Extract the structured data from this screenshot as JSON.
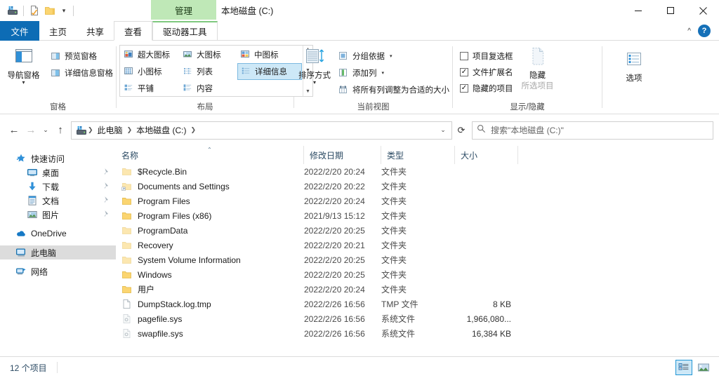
{
  "window": {
    "title": "本地磁盘 (C:)",
    "contextual_tab_label": "管理",
    "controls": {
      "minimize": "minimize-icon",
      "maximize": "maximize-icon",
      "close": "close-icon"
    }
  },
  "quick_access_toolbar": {
    "items": [
      {
        "name": "drive-icon",
        "label": ""
      },
      {
        "name": "properties-icon",
        "label": ""
      },
      {
        "name": "new-folder-icon",
        "label": ""
      }
    ],
    "customize_label": "▾"
  },
  "tabs": [
    {
      "label": "文件",
      "state": "file"
    },
    {
      "label": "主页",
      "state": "normal"
    },
    {
      "label": "共享",
      "state": "normal"
    },
    {
      "label": "查看",
      "state": "active"
    },
    {
      "label": "驱动器工具",
      "state": "contextual"
    }
  ],
  "ribbon_right": {
    "collapse": "^",
    "help": "?"
  },
  "ribbon": {
    "groups": [
      {
        "title": "窗格",
        "big_button": {
          "label": "导航窗格",
          "icon": "navigation-pane-icon",
          "has_dropdown": true
        },
        "small_buttons": [
          {
            "label": "预览窗格",
            "icon": "preview-pane-icon"
          },
          {
            "label": "详细信息窗格",
            "icon": "details-pane-icon"
          }
        ]
      },
      {
        "title": "布局",
        "gallery": [
          {
            "label": "超大图标",
            "icon": "extra-large-icons-icon",
            "selected": false
          },
          {
            "label": "大图标",
            "icon": "large-icons-icon",
            "selected": false
          },
          {
            "label": "中图标",
            "icon": "medium-icons-icon",
            "selected": false
          },
          {
            "label": "小图标",
            "icon": "small-icons-icon",
            "selected": false
          },
          {
            "label": "列表",
            "icon": "list-view-icon",
            "selected": false
          },
          {
            "label": "详细信息",
            "icon": "details-view-icon",
            "selected": true
          },
          {
            "label": "平铺",
            "icon": "tiles-view-icon",
            "selected": false
          },
          {
            "label": "内容",
            "icon": "content-view-icon",
            "selected": false
          }
        ]
      },
      {
        "title": "当前视图",
        "big_button": {
          "label": "排序方式",
          "icon": "sort-by-icon",
          "has_dropdown": true
        },
        "small_buttons": [
          {
            "label": "分组依据",
            "icon": "group-by-icon",
            "has_dropdown": true
          },
          {
            "label": "添加列",
            "icon": "add-columns-icon",
            "has_dropdown": true
          },
          {
            "label": "将所有列调整为合适的大小",
            "icon": "size-all-columns-icon",
            "has_dropdown": false
          }
        ]
      },
      {
        "title": "显示/隐藏",
        "checkboxes": [
          {
            "label": "项目复选框",
            "checked": false
          },
          {
            "label": "文件扩展名",
            "checked": true
          },
          {
            "label": "隐藏的项目",
            "checked": true
          }
        ],
        "big_button": {
          "label": "隐藏",
          "sublabel": "所选项目",
          "icon": "hide-selected-items-icon"
        }
      },
      {
        "title": "",
        "options_button": {
          "label": "选项",
          "icon": "options-icon"
        }
      }
    ]
  },
  "address_bar": {
    "back": "←",
    "forward": "→",
    "recent": "⌄",
    "up": "↑",
    "path_icon": "drive-icon",
    "crumbs": [
      "此电脑",
      "本地磁盘 (C:)"
    ],
    "dropdown": "⌄",
    "refresh": "⟳"
  },
  "search": {
    "icon": "search-icon",
    "placeholder": "搜索\"本地磁盘 (C:)\""
  },
  "nav_pane": {
    "items": [
      {
        "label": "快速访问",
        "icon": "quick-access-star-icon",
        "level": 0,
        "pinned": false,
        "selected": false
      },
      {
        "label": "桌面",
        "icon": "desktop-icon",
        "level": 1,
        "pinned": true,
        "selected": false
      },
      {
        "label": "下载",
        "icon": "downloads-icon",
        "level": 1,
        "pinned": true,
        "selected": false
      },
      {
        "label": "文档",
        "icon": "documents-icon",
        "level": 1,
        "pinned": true,
        "selected": false
      },
      {
        "label": "图片",
        "icon": "pictures-icon",
        "level": 1,
        "pinned": true,
        "selected": false
      },
      {
        "label": "OneDrive",
        "icon": "onedrive-cloud-icon",
        "level": 0,
        "pinned": false,
        "selected": false,
        "gap_before": true
      },
      {
        "label": "此电脑",
        "icon": "this-pc-icon",
        "level": 0,
        "pinned": false,
        "selected": true,
        "gap_before": true
      },
      {
        "label": "网络",
        "icon": "network-icon",
        "level": 0,
        "pinned": false,
        "selected": false,
        "gap_before": true
      }
    ]
  },
  "file_list": {
    "columns": [
      {
        "label": "名称",
        "sorted": true,
        "sort_dir": "asc"
      },
      {
        "label": "修改日期",
        "sorted": false
      },
      {
        "label": "类型",
        "sorted": false
      },
      {
        "label": "大小",
        "sorted": false
      }
    ],
    "rows": [
      {
        "name": "$Recycle.Bin",
        "date": "2022/2/20 20:24",
        "type": "文件夹",
        "size": "",
        "icon": "folder-icon",
        "hidden": true
      },
      {
        "name": "Documents and Settings",
        "date": "2022/2/20 20:22",
        "type": "文件夹",
        "size": "",
        "icon": "folder-shortcut-icon",
        "hidden": true
      },
      {
        "name": "Program Files",
        "date": "2022/2/20 20:24",
        "type": "文件夹",
        "size": "",
        "icon": "folder-icon",
        "hidden": false
      },
      {
        "name": "Program Files (x86)",
        "date": "2021/9/13 15:12",
        "type": "文件夹",
        "size": "",
        "icon": "folder-icon",
        "hidden": false
      },
      {
        "name": "ProgramData",
        "date": "2022/2/20 20:25",
        "type": "文件夹",
        "size": "",
        "icon": "folder-icon",
        "hidden": true
      },
      {
        "name": "Recovery",
        "date": "2022/2/20 20:21",
        "type": "文件夹",
        "size": "",
        "icon": "folder-icon",
        "hidden": true
      },
      {
        "name": "System Volume Information",
        "date": "2022/2/20 20:25",
        "type": "文件夹",
        "size": "",
        "icon": "folder-icon",
        "hidden": true
      },
      {
        "name": "Windows",
        "date": "2022/2/20 20:25",
        "type": "文件夹",
        "size": "",
        "icon": "folder-icon",
        "hidden": false
      },
      {
        "name": "用户",
        "date": "2022/2/20 20:24",
        "type": "文件夹",
        "size": "",
        "icon": "folder-icon",
        "hidden": false
      },
      {
        "name": "DumpStack.log.tmp",
        "date": "2022/2/26 16:56",
        "type": "TMP 文件",
        "size": "8 KB",
        "icon": "generic-file-icon",
        "hidden": false
      },
      {
        "name": "pagefile.sys",
        "date": "2022/2/26 16:56",
        "type": "系统文件",
        "size": "1,966,080...",
        "icon": "system-file-icon",
        "hidden": true
      },
      {
        "name": "swapfile.sys",
        "date": "2022/2/26 16:56",
        "type": "系统文件",
        "size": "16,384 KB",
        "icon": "system-file-icon",
        "hidden": true
      }
    ]
  },
  "status_bar": {
    "item_count": "12 个项目",
    "view_buttons": [
      {
        "name": "details-view-button",
        "selected": true
      },
      {
        "name": "large-icons-view-button",
        "selected": false
      }
    ]
  },
  "colors": {
    "accent": "#0d6cb5",
    "contextual_green": "#bfe8b7",
    "selection": "#cde8f7",
    "header_text": "#2b4a63",
    "folder_yellow": "#fbd571"
  }
}
